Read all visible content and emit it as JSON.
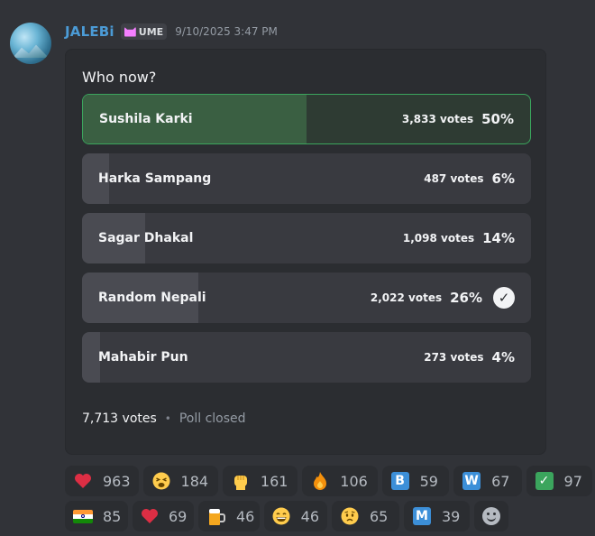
{
  "message": {
    "author": "JALEBi",
    "tag": "UME",
    "timestamp": "9/10/2025 3:47 PM"
  },
  "poll": {
    "question": "Who now?",
    "answers": [
      {
        "label": "Sushila Karki",
        "votes": "3,833 votes",
        "pct": "50%",
        "fraction": 0.5,
        "winner": true,
        "voted": false
      },
      {
        "label": "Harka Sampang",
        "votes": "487 votes",
        "pct": "6%",
        "fraction": 0.06,
        "winner": false,
        "voted": false
      },
      {
        "label": "Sagar Dhakal",
        "votes": "1,098 votes",
        "pct": "14%",
        "fraction": 0.14,
        "winner": false,
        "voted": false
      },
      {
        "label": "Random Nepali",
        "votes": "2,022 votes",
        "pct": "26%",
        "fraction": 0.26,
        "winner": false,
        "voted": true
      },
      {
        "label": "Mahabir Pun",
        "votes": "273 votes",
        "pct": "4%",
        "fraction": 0.04,
        "winner": false,
        "voted": false
      }
    ],
    "total_votes": "7,713 votes",
    "dot": "•",
    "status": "Poll closed"
  },
  "reactions": {
    "row1": [
      {
        "emoji": "heart",
        "count": "963"
      },
      {
        "emoji": "tired-face",
        "count": "184"
      },
      {
        "emoji": "raised-fist",
        "count": "161"
      },
      {
        "emoji": "fire",
        "count": "106"
      },
      {
        "emoji": "letter-b",
        "count": "59"
      },
      {
        "emoji": "letter-w",
        "count": "67"
      },
      {
        "emoji": "check-mark",
        "count": "97"
      }
    ],
    "row2": [
      {
        "emoji": "india-flag",
        "count": "85"
      },
      {
        "emoji": "heart",
        "count": "69"
      },
      {
        "emoji": "beer-mug",
        "count": "46"
      },
      {
        "emoji": "grinning-face",
        "count": "46"
      },
      {
        "emoji": "worried-face",
        "count": "65"
      },
      {
        "emoji": "letter-m",
        "count": "39"
      }
    ]
  },
  "colors": {
    "username": "#4b9bd6",
    "winner_border": "#3ba55d",
    "winner_fill": "#3a5f42",
    "box_emoji_blue": "#3c8fd8",
    "check_green": "#3ba55d"
  }
}
